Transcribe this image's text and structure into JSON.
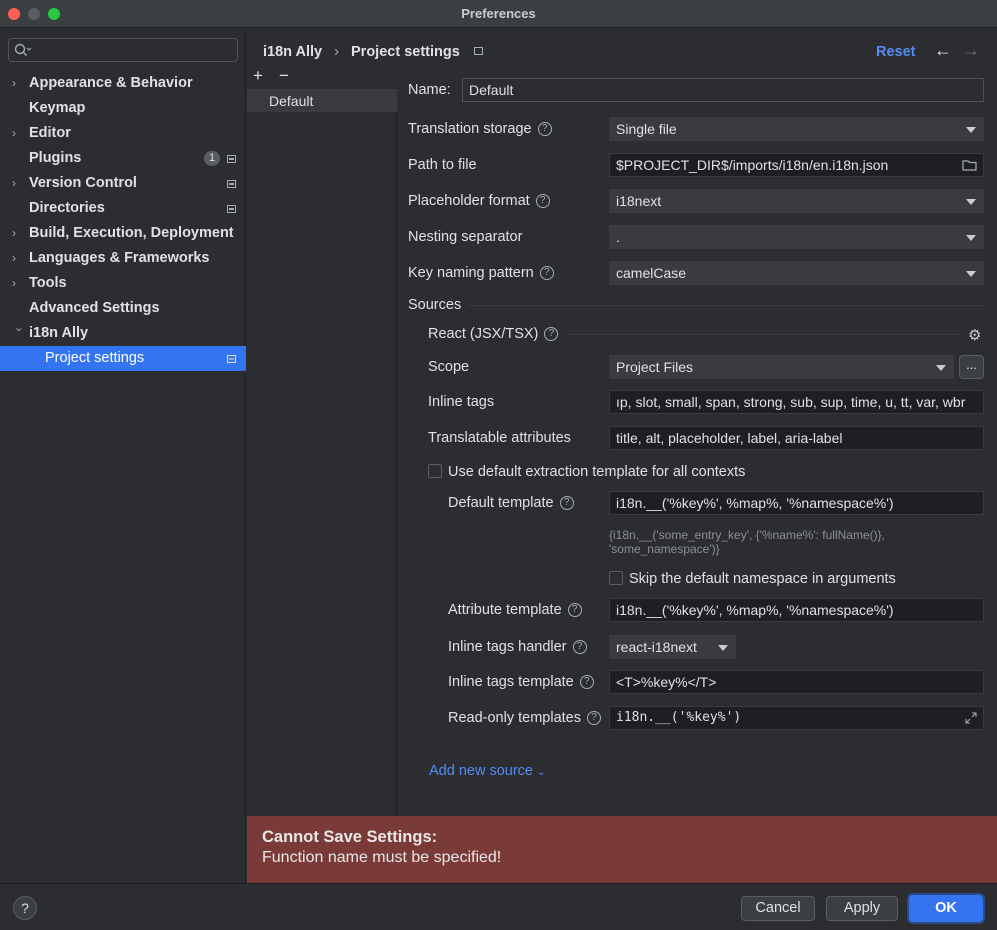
{
  "window": {
    "title": "Preferences"
  },
  "sidebar": {
    "search_placeholder": "",
    "items": [
      {
        "label": "Appearance & Behavior",
        "expandable": true
      },
      {
        "label": "Keymap",
        "expandable": false
      },
      {
        "label": "Editor",
        "expandable": true
      },
      {
        "label": "Plugins",
        "expandable": false,
        "badge": "1"
      },
      {
        "label": "Version Control",
        "expandable": true
      },
      {
        "label": "Directories",
        "expandable": false
      },
      {
        "label": "Build, Execution, Deployment",
        "expandable": true
      },
      {
        "label": "Languages & Frameworks",
        "expandable": true
      },
      {
        "label": "Tools",
        "expandable": true
      },
      {
        "label": "Advanced Settings",
        "expandable": false
      },
      {
        "label": "i18n Ally",
        "expandable": true,
        "expanded": true
      },
      {
        "label": "Project settings",
        "selected": true
      }
    ]
  },
  "header": {
    "breadcrumb_root": "i18n Ally",
    "breadcrumb_sep": "›",
    "breadcrumb_current": "Project settings",
    "reset_label": "Reset",
    "back_icon": "arrow-left-icon",
    "forward_icon": "arrow-right-icon"
  },
  "profiles": {
    "add_label": "+",
    "remove_label": "−",
    "items": [
      "Default"
    ]
  },
  "form": {
    "name_label": "Name:",
    "name_value": "Default",
    "translation_storage_label": "Translation storage",
    "translation_storage_value": "Single file",
    "path_label": "Path to file",
    "path_value": "$PROJECT_DIR$/imports/i18n/en.i18n.json",
    "placeholder_label": "Placeholder format",
    "placeholder_value": "i18next",
    "nesting_label": "Nesting separator",
    "nesting_value": ".",
    "key_naming_label": "Key naming pattern",
    "key_naming_value": "camelCase",
    "sources_label": "Sources",
    "react_label": "React (JSX/TSX)",
    "scope_label": "Scope",
    "scope_value": "Project Files",
    "scope_more": "...",
    "inline_tags_label": "Inline tags",
    "inline_tags_value": "ıp, slot, small, span, strong, sub, sup, time, u, tt, var, wbr",
    "translatable_label": "Translatable attributes",
    "translatable_value": "title, alt, placeholder, label, aria-label",
    "use_default_label": "Use default extraction template for all contexts",
    "default_template_label": "Default template",
    "default_template_value": "i18n.__('%key%', %map%, '%namespace%')",
    "default_template_hint_1": "{i18n.__('some_entry_key', {'%name%': fullName()},",
    "default_template_hint_2": "'some_namespace')}",
    "skip_namespace_label": "Skip the default namespace in arguments",
    "attribute_template_label": "Attribute template",
    "attribute_template_value": "i18n.__('%key%', %map%, '%namespace%')",
    "inline_handler_label": "Inline tags handler",
    "inline_handler_value": "react-i18next",
    "inline_template_label": "Inline tags template",
    "inline_template_value": "<T>%key%</T>",
    "readonly_label": "Read-only templates",
    "readonly_value": "i18n.__('%key%')",
    "add_source_label": "Add new source"
  },
  "error": {
    "title": "Cannot Save Settings:",
    "message": "Function name must be specified!"
  },
  "footer": {
    "help_label": "?",
    "cancel_label": "Cancel",
    "apply_label": "Apply",
    "ok_label": "OK"
  },
  "colors": {
    "accent": "#3574f0",
    "error_bg": "#7a3b38",
    "link": "#548af7"
  }
}
